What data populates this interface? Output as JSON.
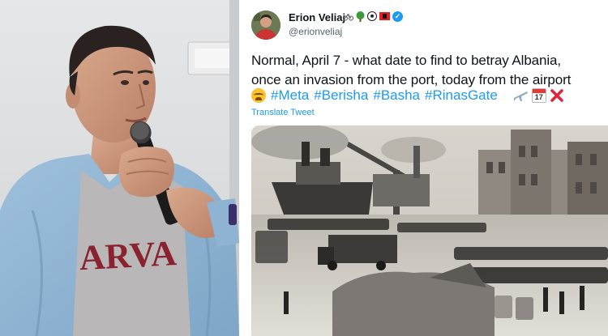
{
  "photo": {
    "shirt_print": "ARVA"
  },
  "tweet": {
    "author": {
      "name": "Erion Veliaj",
      "handle": "@erionveliaj",
      "verified": true,
      "name_emojis": [
        "bicycle-icon",
        "tree-icon",
        "soccer-ball-icon",
        "albania-flag-icon"
      ]
    },
    "text_lines": [
      "Normal, April 7 - what date to find to betray Albania,",
      "once an invasion from the port, today from the airport"
    ],
    "hashtags": [
      "#Meta",
      "#Berisha",
      "#Basha",
      "#RinasGate"
    ],
    "trailing_emojis": [
      "airplane-icon",
      "calendar-icon",
      "cross-mark-icon"
    ],
    "calendar_day": "17",
    "translate_label": "Translate Tweet",
    "media_description_icons": [
      "historic-port-photo"
    ]
  },
  "colors": {
    "link_blue": "#1d9bf0",
    "text_primary": "#0f1419",
    "text_secondary": "#536471"
  }
}
